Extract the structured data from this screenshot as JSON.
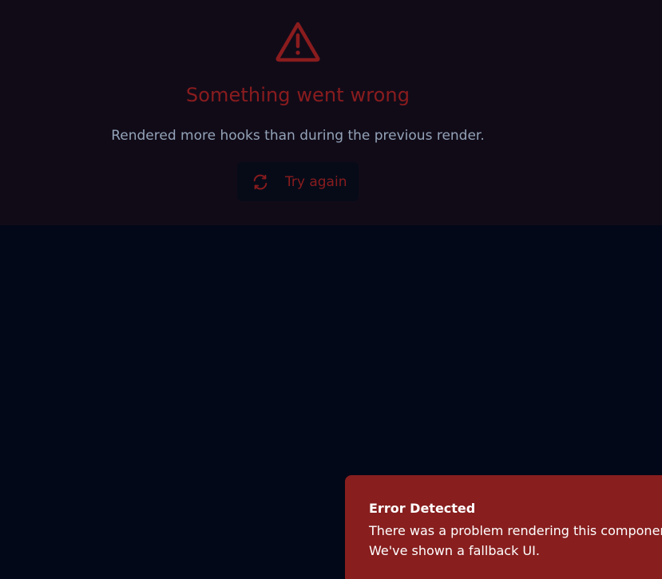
{
  "error_panel": {
    "icon": "warning-triangle-icon",
    "title": "Something went wrong",
    "message": "Rendered more hooks than during the previous render.",
    "retry_button": {
      "icon": "refresh-icon",
      "label": "Try again"
    }
  },
  "toast": {
    "title": "Error Detected",
    "line1": "There was a problem rendering this component",
    "line2": "We've shown a fallback UI."
  },
  "colors": {
    "background": "#020817",
    "panel": "#110b18",
    "accent_red": "#8a1c1e",
    "muted_text": "#94a3b8",
    "toast_bg": "#881e1e"
  }
}
